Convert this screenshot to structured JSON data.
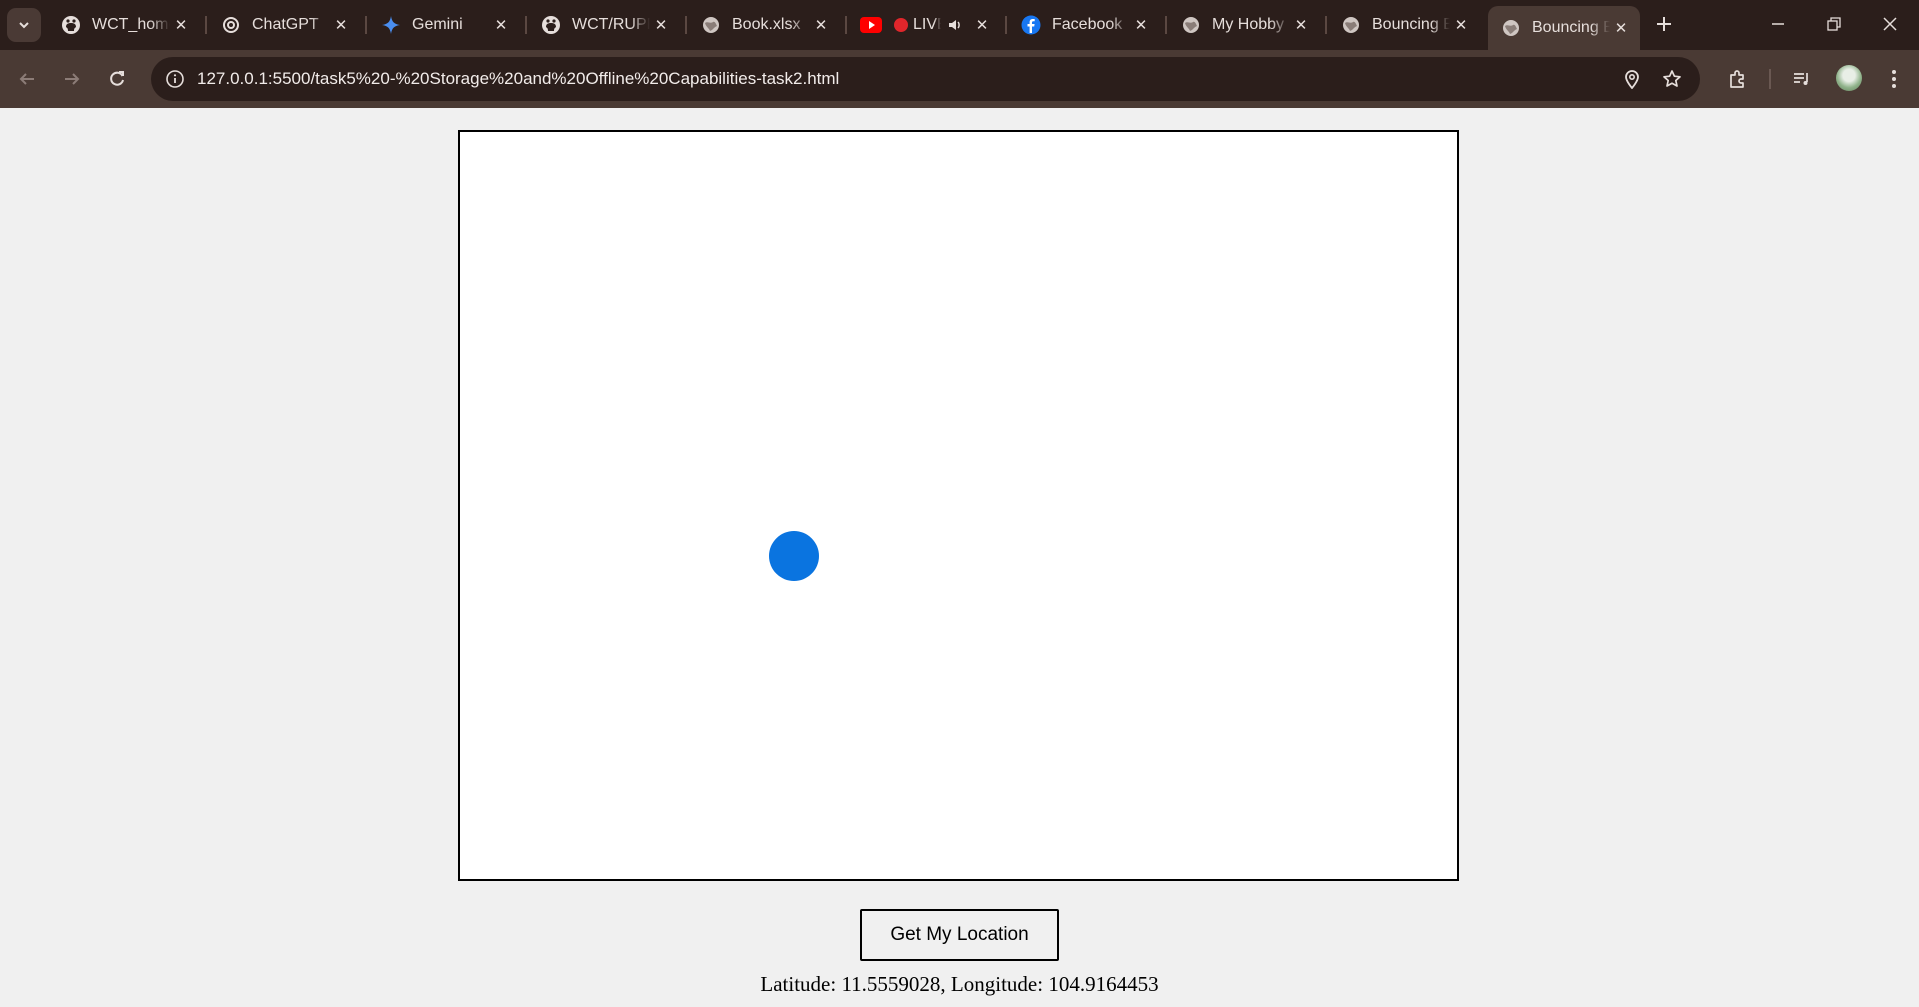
{
  "browser": {
    "tabs": [
      {
        "title": "WCT_home",
        "icon": "github-icon"
      },
      {
        "title": "ChatGPT",
        "icon": "chatgpt-icon"
      },
      {
        "title": "Gemini",
        "icon": "gemini-icon"
      },
      {
        "title": "WCT/RUPP",
        "icon": "github-icon"
      },
      {
        "title": "Book.xlsx",
        "icon": "globe-icon"
      },
      {
        "title": "LIVE",
        "icon": "youtube-icon"
      },
      {
        "title": "Facebook",
        "icon": "facebook-icon"
      },
      {
        "title": "My Hobby",
        "icon": "globe-icon"
      },
      {
        "title": "Bouncing Ball",
        "icon": "globe-icon"
      },
      {
        "title": "Bouncing Ball",
        "icon": "globe-icon",
        "active": true
      }
    ],
    "url": "127.0.0.1:5500/task5%20-%20Storage%20and%20Offline%20Capabilities-task2.html"
  },
  "page": {
    "ball_color": "#0a74e0",
    "location_button_label": "Get My Location",
    "coordinates_text": "Latitude: 11.5559028, Longitude: 104.9164453"
  },
  "colors": {
    "tabstrip_bg": "#2b1e1b",
    "toolbar_bg": "#4a3a34",
    "page_bg": "#f0f0f0",
    "youtube_red": "#ff0000",
    "recording_red": "#e0262b",
    "facebook_blue": "#1877f2",
    "gemini_blue": "#4a8ef0"
  }
}
